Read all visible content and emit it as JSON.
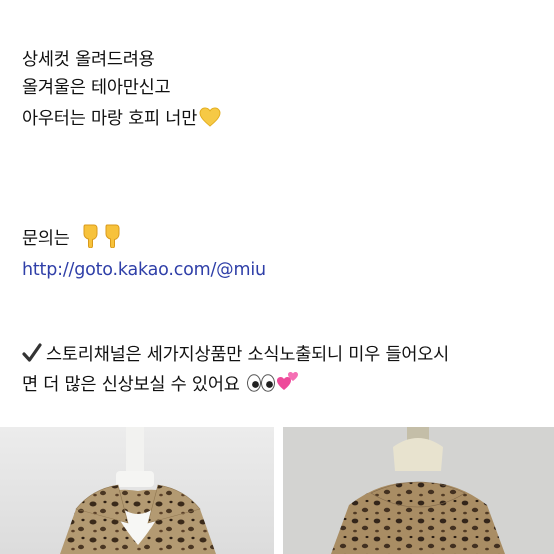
{
  "post": {
    "line1": "상세컷 올려드려용",
    "line2": "올겨울은 테아만신고",
    "line3": "아우터는 마랑 호피 너만",
    "inquiry_label": "문의는",
    "link": "http://goto.kakao.com/@miu",
    "notice_line1": "스토리채널은 세가지상품만 소식노출되니 미우 들어오시",
    "notice_line2": "면 더 많은 신상보실 수 있어요"
  },
  "emoji": {
    "after_line3": "yellow-heart-icon",
    "after_inquiry": [
      "finger-down-icon",
      "finger-down-icon"
    ],
    "before_notice": "check-mark-icon",
    "after_notice": [
      "eyes-icon",
      "two-hearts-icon"
    ]
  },
  "photos": [
    {
      "name": "leopard-fur-jacket-on-mannequin-front"
    },
    {
      "name": "leopard-fur-jacket-on-mannequin-back"
    }
  ],
  "colors": {
    "link": "#2f3fa8",
    "text": "#111111",
    "leopard_base": "#b39a72",
    "leopard_spot": "#3a2a1a"
  }
}
